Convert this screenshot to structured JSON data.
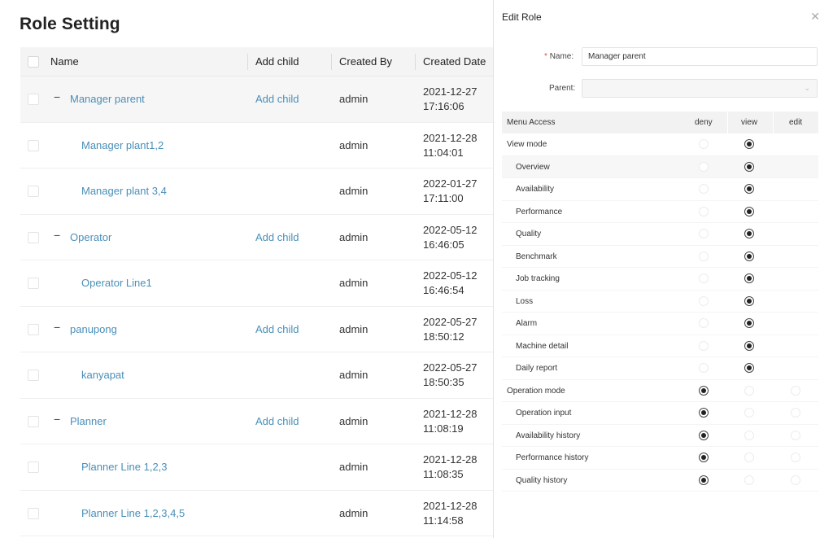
{
  "page": {
    "title": "Role Setting"
  },
  "table": {
    "headers": {
      "name": "Name",
      "add_child": "Add child",
      "created_by": "Created By",
      "created_date": "Created Date"
    },
    "rows": [
      {
        "name": "Manager parent",
        "level": 0,
        "expander": "−",
        "add_child": "Add child",
        "created_by": "admin",
        "date": "2021-12-27",
        "time": "17:16:06"
      },
      {
        "name": "Manager plant1,2",
        "level": 1,
        "expander": "",
        "add_child": "",
        "created_by": "admin",
        "date": "2021-12-28",
        "time": "11:04:01"
      },
      {
        "name": "Manager plant 3,4",
        "level": 1,
        "expander": "",
        "add_child": "",
        "created_by": "admin",
        "date": "2022-01-27",
        "time": "17:11:00"
      },
      {
        "name": "Operator",
        "level": 0,
        "expander": "−",
        "add_child": "Add child",
        "created_by": "admin",
        "date": "2022-05-12",
        "time": "16:46:05"
      },
      {
        "name": "Operator Line1",
        "level": 1,
        "expander": "",
        "add_child": "",
        "created_by": "admin",
        "date": "2022-05-12",
        "time": "16:46:54"
      },
      {
        "name": "panupong",
        "level": 0,
        "expander": "−",
        "add_child": "Add child",
        "created_by": "admin",
        "date": "2022-05-27",
        "time": "18:50:12"
      },
      {
        "name": "kanyapat",
        "level": 1,
        "expander": "",
        "add_child": "",
        "created_by": "admin",
        "date": "2022-05-27",
        "time": "18:50:35"
      },
      {
        "name": "Planner",
        "level": 0,
        "expander": "−",
        "add_child": "Add child",
        "created_by": "admin",
        "date": "2021-12-28",
        "time": "11:08:19"
      },
      {
        "name": "Planner Line 1,2,3",
        "level": 1,
        "expander": "",
        "add_child": "",
        "created_by": "admin",
        "date": "2021-12-28",
        "time": "11:08:35"
      },
      {
        "name": "Planner Line 1,2,3,4,5",
        "level": 1,
        "expander": "",
        "add_child": "",
        "created_by": "admin",
        "date": "2021-12-28",
        "time": "11:14:58"
      }
    ]
  },
  "modal": {
    "title": "Edit Role",
    "close_icon": "close-icon",
    "name_label": "Name",
    "name_label_suffix": ":",
    "required_mark": "*",
    "name_value": "Manager parent",
    "parent_label": "Parent",
    "parent_label_suffix": ":",
    "parent_value": "",
    "caret_icon": "chevron-down-icon",
    "access_headers": {
      "menu": "Menu Access",
      "deny": "deny",
      "view": "view",
      "edit": "edit"
    },
    "access_rows": [
      {
        "name": "View mode",
        "level": 0,
        "value": "view"
      },
      {
        "name": "Overview",
        "level": 1,
        "value": "view"
      },
      {
        "name": "Availability",
        "level": 1,
        "value": "view"
      },
      {
        "name": "Performance",
        "level": 1,
        "value": "view"
      },
      {
        "name": "Quality",
        "level": 1,
        "value": "view"
      },
      {
        "name": "Benchmark",
        "level": 1,
        "value": "view"
      },
      {
        "name": "Job tracking",
        "level": 1,
        "value": "view"
      },
      {
        "name": "Loss",
        "level": 1,
        "value": "view"
      },
      {
        "name": "Alarm",
        "level": 1,
        "value": "view"
      },
      {
        "name": "Machine detail",
        "level": 1,
        "value": "view"
      },
      {
        "name": "Daily report",
        "level": 1,
        "value": "view"
      },
      {
        "name": "Operation mode",
        "level": 0,
        "value": "deny"
      },
      {
        "name": "Operation input",
        "level": 1,
        "value": "deny"
      },
      {
        "name": "Availability history",
        "level": 1,
        "value": "deny"
      },
      {
        "name": "Performance history",
        "level": 1,
        "value": "deny"
      },
      {
        "name": "Quality history",
        "level": 1,
        "value": "deny"
      }
    ]
  }
}
